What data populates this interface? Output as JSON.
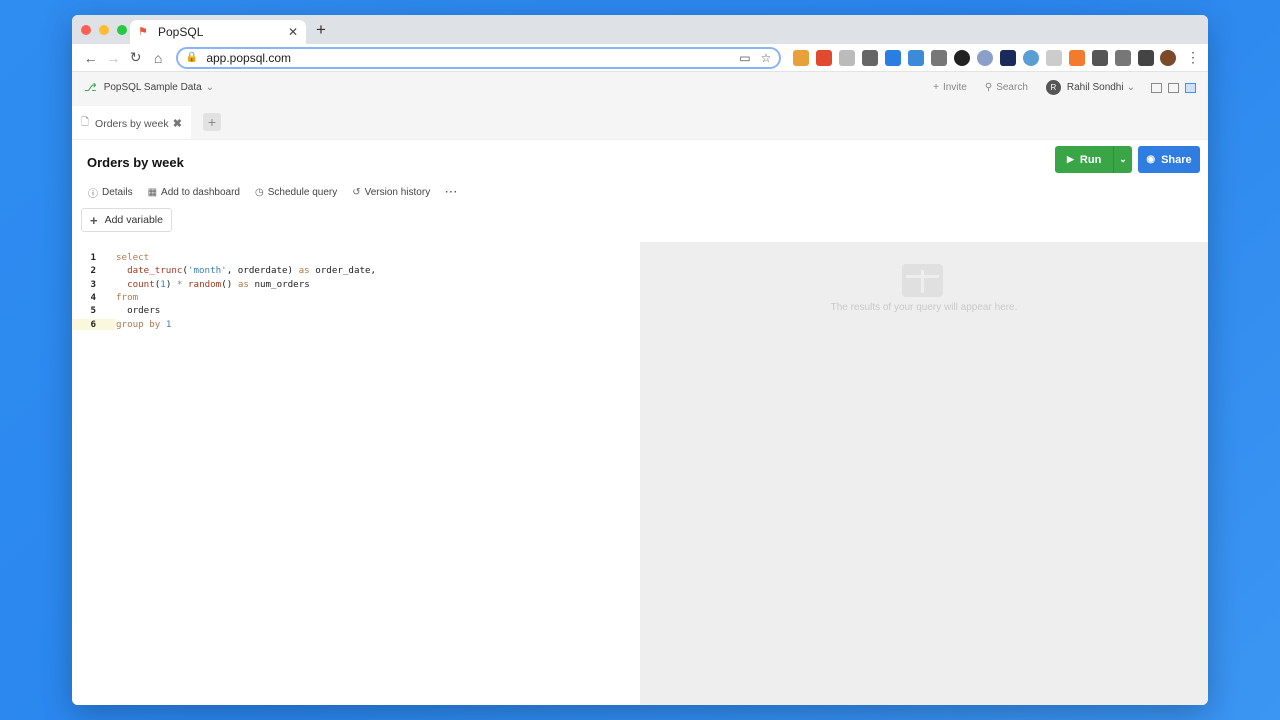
{
  "browser": {
    "tab_title": "PopSQL",
    "url": "app.popsql.com"
  },
  "header": {
    "database": "PopSQL Sample Data",
    "invite": "Invite",
    "search": "Search",
    "user_initial": "R",
    "user_name": "Rahil Sondhi"
  },
  "query_tabs": [
    {
      "label": "Orders by week"
    }
  ],
  "query": {
    "title": "Orders by week",
    "actions": {
      "details": "Details",
      "add_to_dashboard": "Add to dashboard",
      "schedule": "Schedule query",
      "version_history": "Version history",
      "more": "···"
    },
    "add_variable": "Add variable",
    "run": "Run",
    "share": "Share"
  },
  "editor": {
    "line_numbers": [
      "1",
      "2",
      "3",
      "4",
      "5",
      "6"
    ]
  },
  "results": {
    "empty_message": "The results of your query will appear here."
  },
  "colors": {
    "run_button": "#3aa547",
    "share_button": "#2f7de1",
    "background": "#2f8cf0"
  }
}
